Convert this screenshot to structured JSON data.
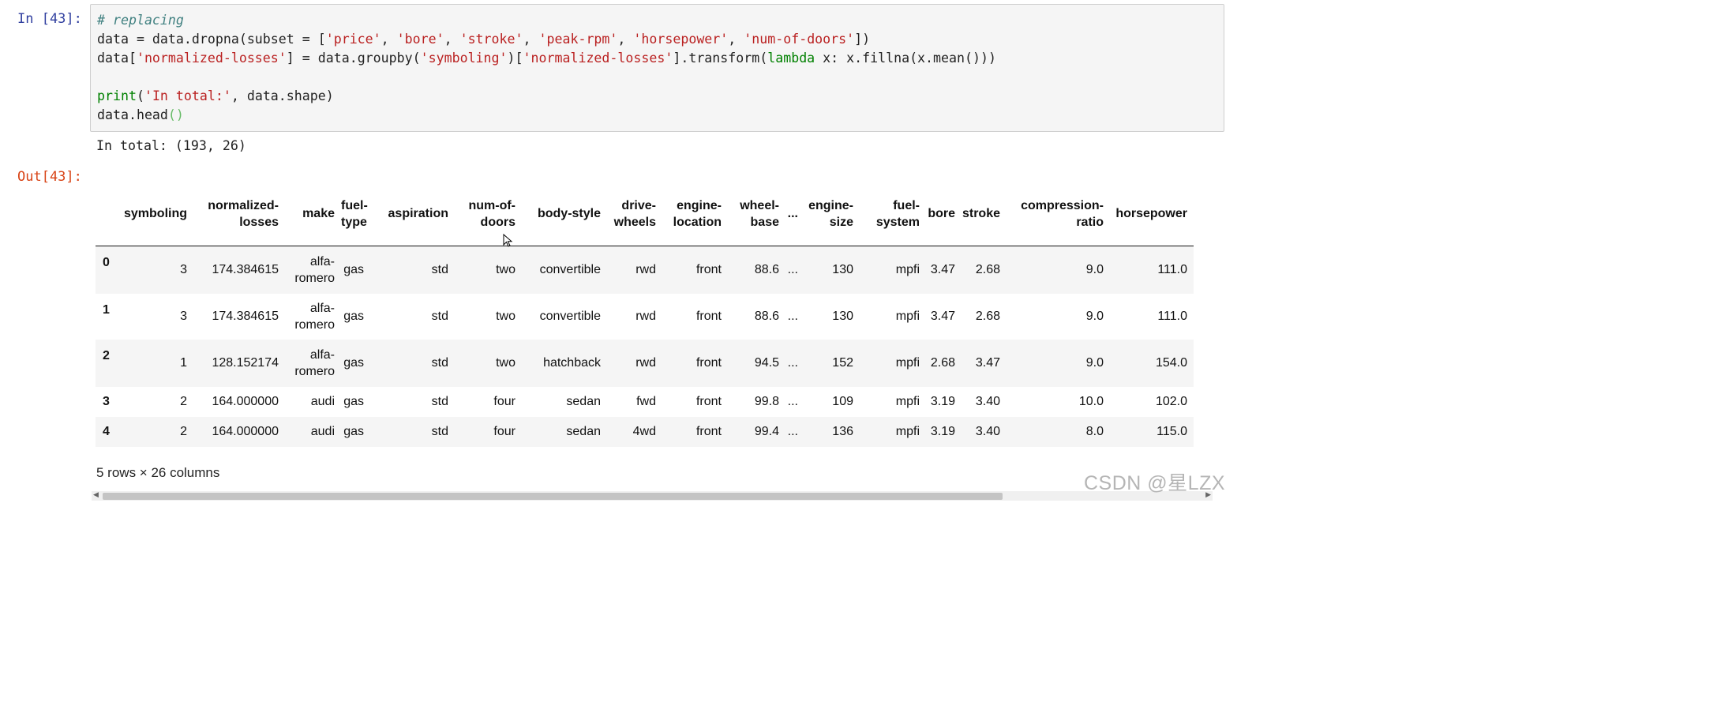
{
  "input_prompt": "In [43]:",
  "output_prompt": "Out[43]:",
  "code_lines": [
    "# replacing",
    "data = data.dropna(subset = ['price', 'bore', 'stroke', 'peak-rpm', 'horsepower', 'num-of-doors'])",
    "data['normalized-losses'] = data.groupby('symboling')['normalized-losses'].transform(lambda x: x.fillna(x.mean()))",
    "",
    "print('In total:', data.shape)",
    "data.head()"
  ],
  "stream_output": "In total: (193, 26)",
  "table": {
    "columns": [
      "symboling",
      "normalized-losses",
      "make",
      "fuel-type",
      "aspiration",
      "num-of-doors",
      "body-style",
      "drive-wheels",
      "engine-location",
      "wheel-base",
      "...",
      "engine-size",
      "fuel-system",
      "bore",
      "stroke",
      "compression-ratio",
      "horsepower"
    ],
    "rows": [
      {
        "index": "0",
        "cells": [
          "3",
          "174.384615",
          "alfa-romero",
          "gas",
          "std",
          "two",
          "convertible",
          "rwd",
          "front",
          "88.6",
          "...",
          "130",
          "mpfi",
          "3.47",
          "2.68",
          "9.0",
          "111.0"
        ]
      },
      {
        "index": "1",
        "cells": [
          "3",
          "174.384615",
          "alfa-romero",
          "gas",
          "std",
          "two",
          "convertible",
          "rwd",
          "front",
          "88.6",
          "...",
          "130",
          "mpfi",
          "3.47",
          "2.68",
          "9.0",
          "111.0"
        ]
      },
      {
        "index": "2",
        "cells": [
          "1",
          "128.152174",
          "alfa-romero",
          "gas",
          "std",
          "two",
          "hatchback",
          "rwd",
          "front",
          "94.5",
          "...",
          "152",
          "mpfi",
          "2.68",
          "3.47",
          "9.0",
          "154.0"
        ]
      },
      {
        "index": "3",
        "cells": [
          "2",
          "164.000000",
          "audi",
          "gas",
          "std",
          "four",
          "sedan",
          "fwd",
          "front",
          "99.8",
          "...",
          "109",
          "mpfi",
          "3.19",
          "3.40",
          "10.0",
          "102.0"
        ]
      },
      {
        "index": "4",
        "cells": [
          "2",
          "164.000000",
          "audi",
          "gas",
          "std",
          "four",
          "sedan",
          "4wd",
          "front",
          "99.4",
          "...",
          "136",
          "mpfi",
          "3.19",
          "3.40",
          "8.0",
          "115.0"
        ]
      }
    ]
  },
  "rows_info": "5 rows × 26 columns",
  "watermark": "CSDN @星LZX",
  "colors": {
    "input_prompt": "#303f9f",
    "output_prompt": "#d84315",
    "string": "#ba2121",
    "comment": "#408080",
    "keyword": "#008000"
  }
}
